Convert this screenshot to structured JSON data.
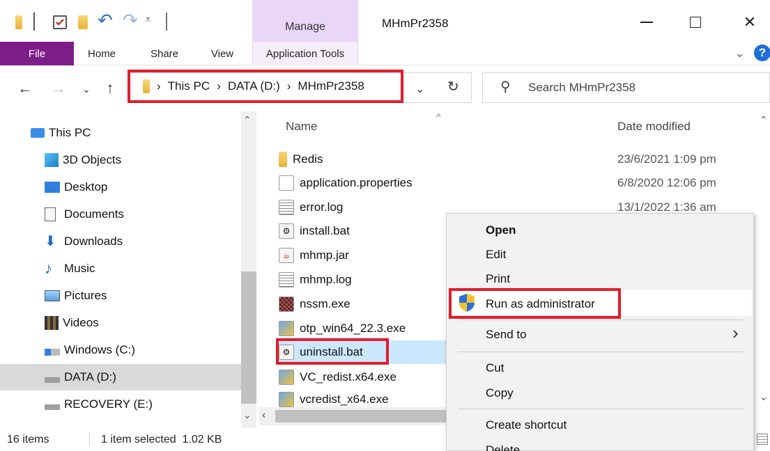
{
  "window": {
    "title": "MHmPr2358",
    "manage_tab": "Manage"
  },
  "ribbon": {
    "tabs": [
      "File",
      "Home",
      "Share",
      "View",
      "Application Tools"
    ]
  },
  "address": {
    "crumbs": [
      "This PC",
      "DATA (D:)",
      "MHmPr2358"
    ],
    "search_placeholder": "Search MHmPr2358"
  },
  "nav": {
    "items": [
      {
        "label": "This PC",
        "icon": "pc-icon"
      },
      {
        "label": "3D Objects",
        "icon": "3d-objects-icon"
      },
      {
        "label": "Desktop",
        "icon": "desktop-icon"
      },
      {
        "label": "Documents",
        "icon": "documents-icon"
      },
      {
        "label": "Downloads",
        "icon": "downloads-icon"
      },
      {
        "label": "Music",
        "icon": "music-icon"
      },
      {
        "label": "Pictures",
        "icon": "pictures-icon"
      },
      {
        "label": "Videos",
        "icon": "videos-icon"
      },
      {
        "label": "Windows (C:)",
        "icon": "drive-c-icon"
      },
      {
        "label": "DATA (D:)",
        "icon": "drive-icon"
      },
      {
        "label": "RECOVERY (E:)",
        "icon": "drive-icon"
      }
    ]
  },
  "files": {
    "columns": [
      "Name",
      "Date modified"
    ],
    "rows": [
      {
        "name": "Redis",
        "date": "23/6/2021 1:09 pm",
        "icon": "folder-icon"
      },
      {
        "name": "application.properties",
        "date": "6/8/2020 12:06 pm",
        "icon": "file-icon"
      },
      {
        "name": "error.log",
        "date": "13/1/2022 1:36 am",
        "icon": "text-file-icon"
      },
      {
        "name": "install.bat",
        "date": "",
        "icon": "batch-file-icon"
      },
      {
        "name": "mhmp.jar",
        "date": "",
        "icon": "jar-file-icon"
      },
      {
        "name": "mhmp.log",
        "date": "",
        "icon": "text-file-icon"
      },
      {
        "name": "nssm.exe",
        "date": "",
        "icon": "exe-icon"
      },
      {
        "name": "otp_win64_22.3.exe",
        "date": "",
        "icon": "installer-icon"
      },
      {
        "name": "uninstall.bat",
        "date": "",
        "icon": "batch-file-icon"
      },
      {
        "name": "VC_redist.x64.exe",
        "date": "",
        "icon": "installer-icon"
      },
      {
        "name": "vcredist_x64.exe",
        "date": "",
        "icon": "installer-icon"
      }
    ]
  },
  "status": {
    "count": "16 items",
    "selection": "1 item selected  1.02 KB"
  },
  "context_menu": {
    "open": "Open",
    "edit": "Edit",
    "print": "Print",
    "run_admin": "Run as administrator",
    "send_to": "Send to",
    "cut": "Cut",
    "copy": "Copy",
    "create_shortcut": "Create shortcut",
    "delete": "Delete"
  },
  "colors": {
    "file_tab": "#7f1d88",
    "manage_tab": "#ead6f7",
    "highlight": "#e11d2b",
    "selected_row": "#cce8ff"
  }
}
